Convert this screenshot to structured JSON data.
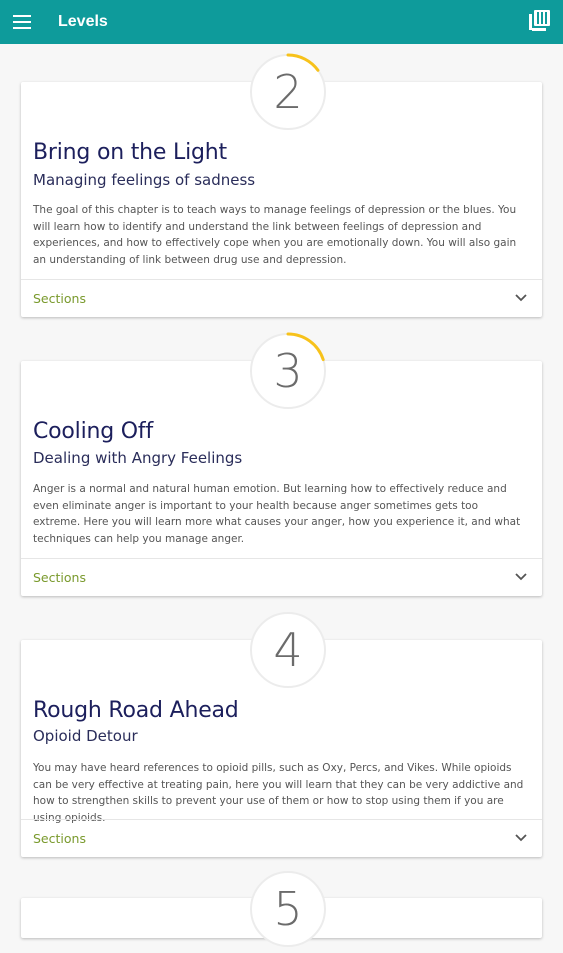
{
  "appbar": {
    "title": "Levels",
    "menu_icon": "hamburger-menu-icon",
    "library_icon": "library-books-icon"
  },
  "colors": {
    "appbar": "#0e9b9b",
    "progress": "#f7c21b",
    "title": "#1c1f5c",
    "sections": "#7a9a2d"
  },
  "levels": [
    {
      "number": "2",
      "progress": 0.15,
      "title": "Bring on the Light",
      "subtitle": "Managing feelings of sadness",
      "description": "The goal of this chapter is to teach ways to manage feelings of depression or the blues. You will learn how to identify and understand the link between feelings of depression and experiences, and how to effectively cope when you are emotionally down. You will also gain an understanding of link between drug use and depression.",
      "sections_label": "Sections"
    },
    {
      "number": "3",
      "progress": 0.2,
      "title": "Cooling Off",
      "subtitle": "Dealing with Angry Feelings",
      "description": "Anger is a normal and natural human emotion. But learning how to effectively reduce and even eliminate anger is important to your health because anger sometimes gets too extreme. Here you will learn more what causes your anger, how you experience it, and what techniques can help you manage anger.",
      "sections_label": "Sections"
    },
    {
      "number": "4",
      "progress": 0,
      "title": "Rough Road Ahead",
      "subtitle": "Opioid Detour",
      "description": "You may have heard references to opioid pills, such as Oxy, Percs, and Vikes. While opioids can be very effective at treating pain, here you will learn that they can be very addictive and how to strengthen skills to prevent your use of them or how to stop using them if you are using opioids.",
      "sections_label": "Sections"
    },
    {
      "number": "5",
      "progress": 0
    }
  ]
}
